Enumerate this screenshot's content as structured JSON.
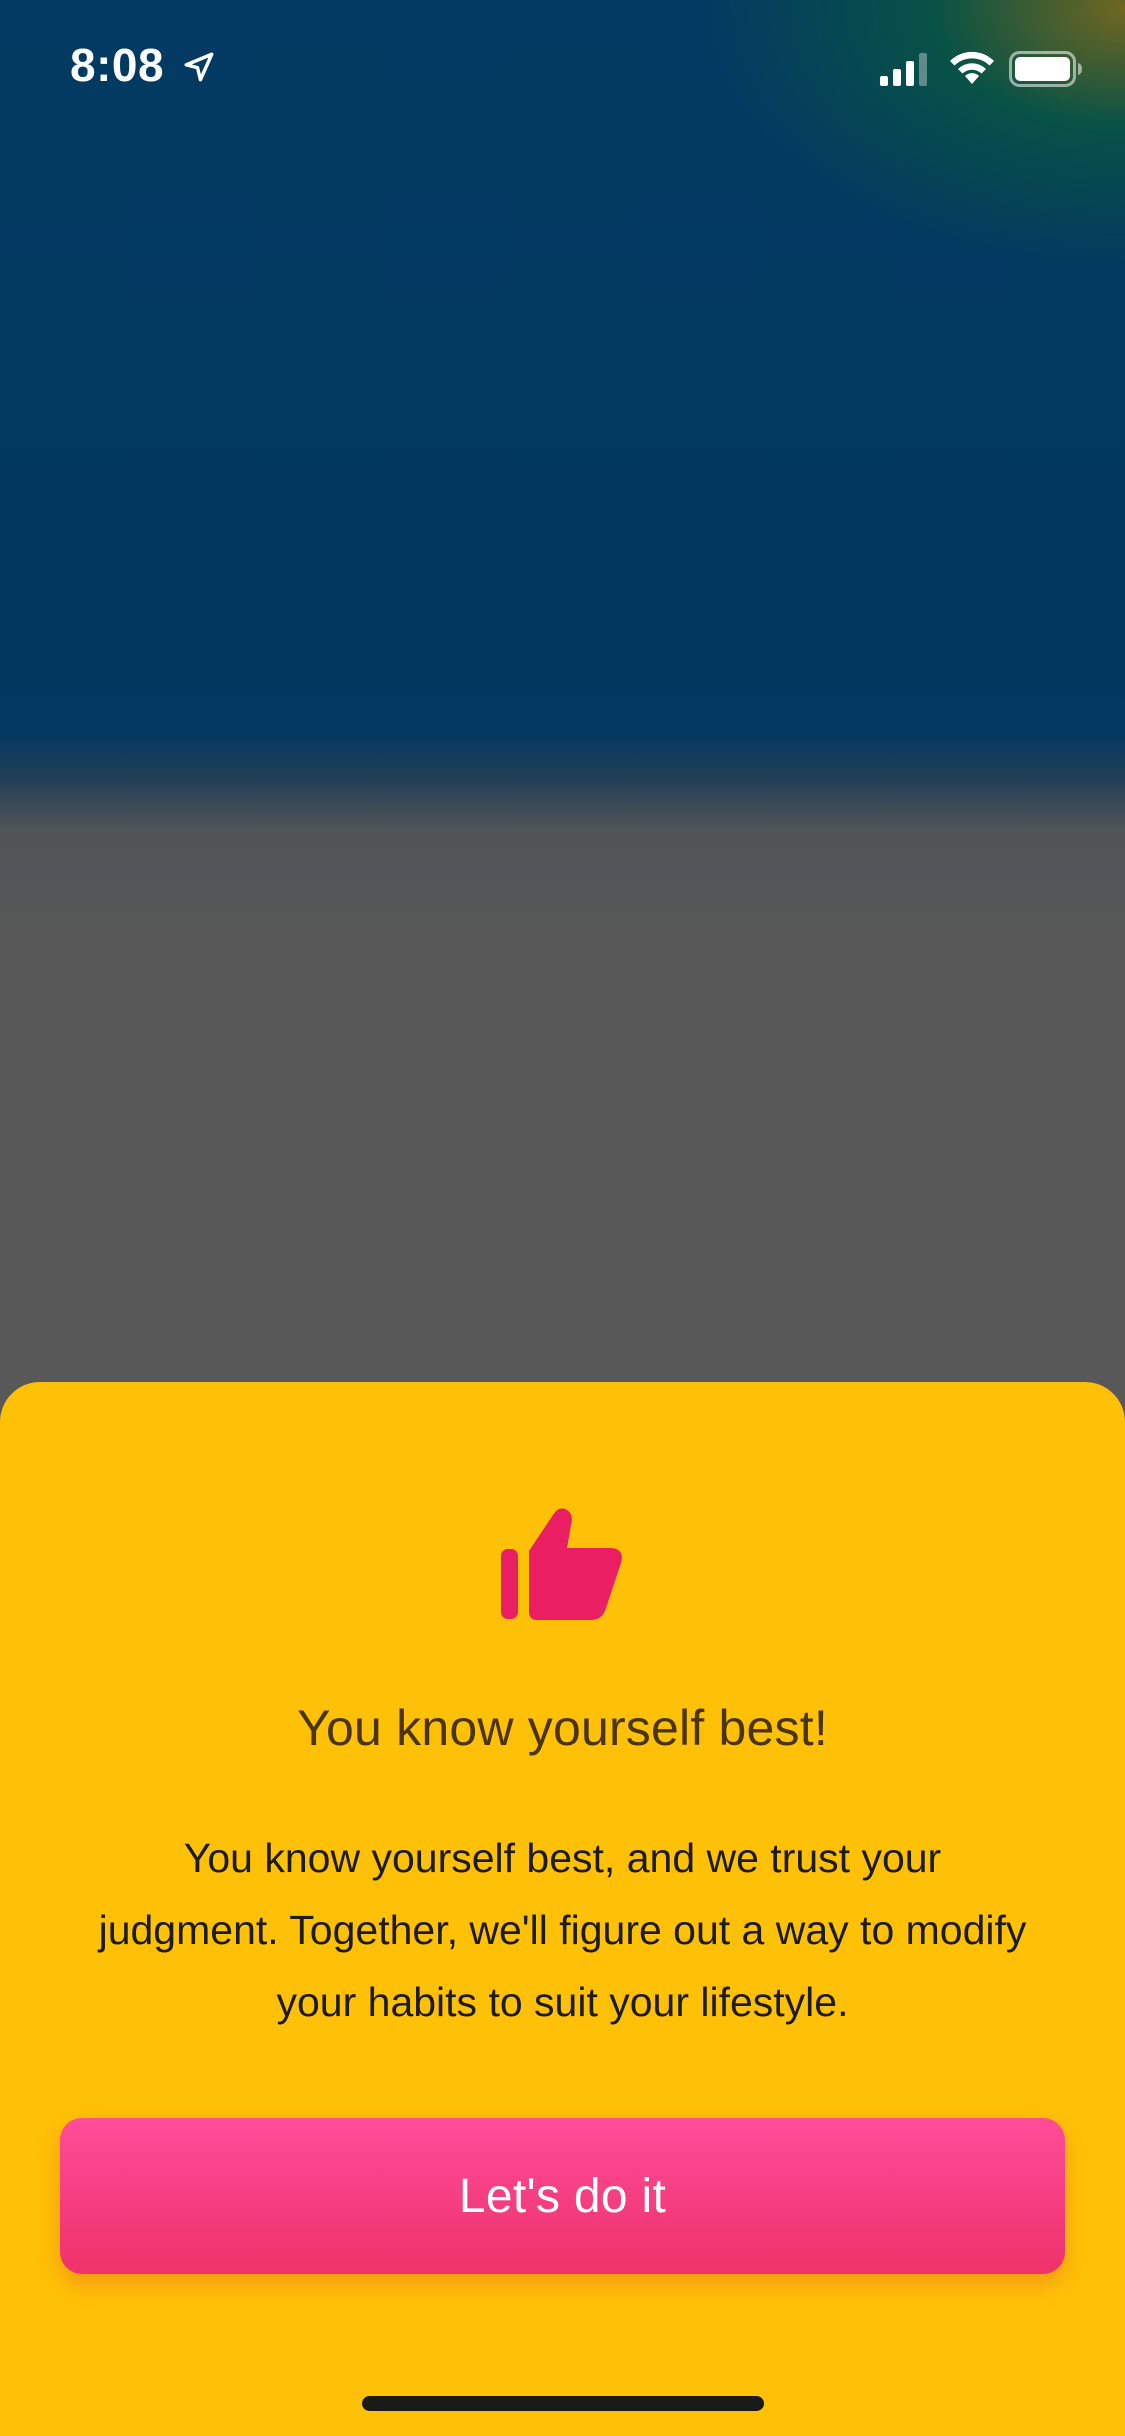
{
  "status_bar": {
    "time": "8:08",
    "icons": [
      "location-arrow-icon",
      "cellular-signal-icon",
      "wifi-icon",
      "battery-icon"
    ]
  },
  "sheet": {
    "background_color": "#ffc107",
    "icon": "thumbs-up-icon",
    "icon_color": "#e91e63",
    "title": "You know yourself best!",
    "body": "You know yourself best, and we trust your judgment. Together, we'll figure out a way to modify your habits to suit your lifestyle.",
    "button_label": "Let's do it",
    "button_color": "#f53d80"
  }
}
